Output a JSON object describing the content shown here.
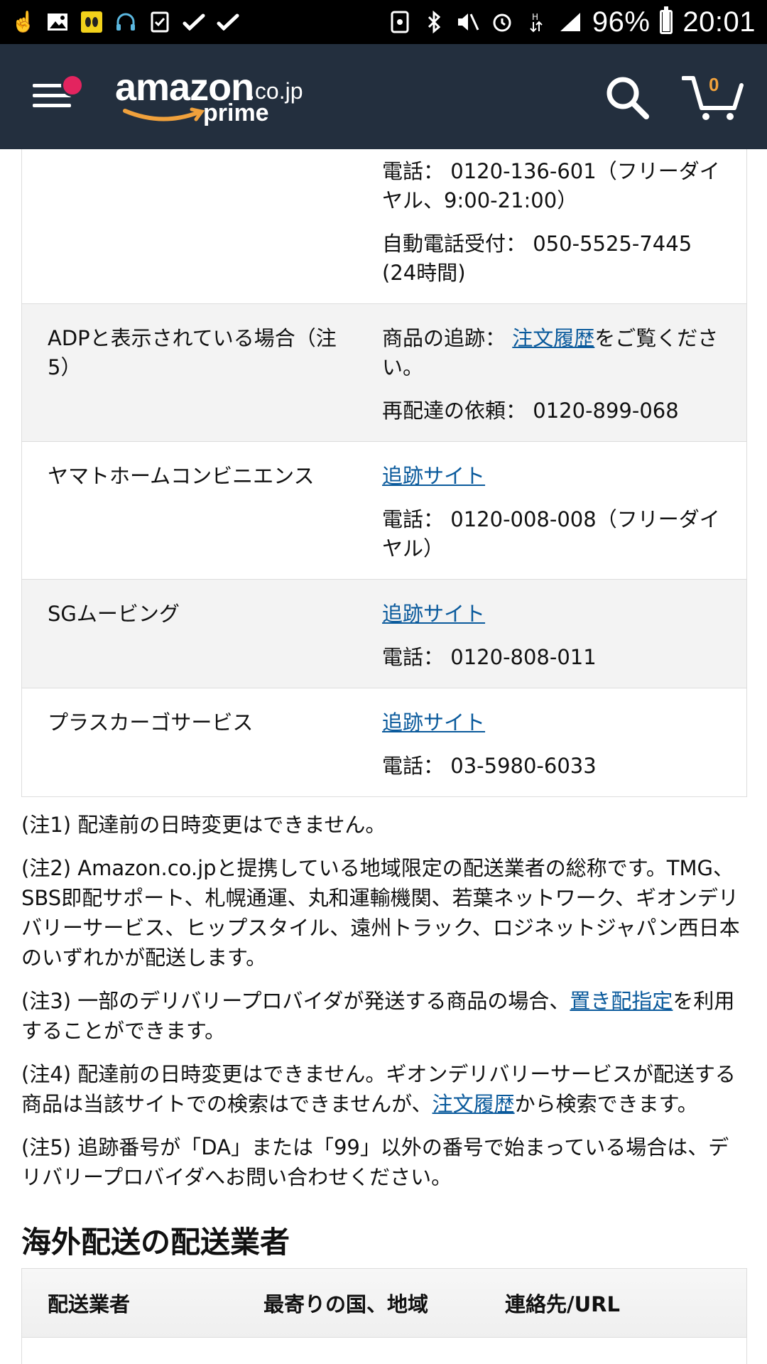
{
  "status_bar": {
    "battery_percent": "96%",
    "battery_level": 0.96,
    "time": "20:01"
  },
  "header": {
    "logo_word": "amazon",
    "logo_tld": ".co.jp",
    "logo_prime": "prime",
    "cart_count": "0"
  },
  "carriers": [
    {
      "name": "",
      "alt": false,
      "info": [
        {
          "prefix": "電話： 0120-136-601（フリーダイヤル、9:00-21:00）",
          "link": "",
          "suffix": ""
        },
        {
          "prefix": "自動電話受付： 050-5525-7445 (24時間)",
          "link": "",
          "suffix": ""
        }
      ]
    },
    {
      "name": "ADPと表示されている場合（注5）",
      "alt": true,
      "info": [
        {
          "prefix": "商品の追跡： ",
          "link": "注文履歴",
          "suffix": "をご覧ください。"
        },
        {
          "prefix": "再配達の依頼： 0120-899-068",
          "link": "",
          "suffix": ""
        }
      ]
    },
    {
      "name": "ヤマトホームコンビニエンス",
      "alt": false,
      "info": [
        {
          "prefix": "",
          "link": "追跡サイト",
          "suffix": ""
        },
        {
          "prefix": "電話： 0120-008-008（フリーダイヤル）",
          "link": "",
          "suffix": ""
        }
      ]
    },
    {
      "name": "SGムービング",
      "alt": true,
      "info": [
        {
          "prefix": "",
          "link": "追跡サイト",
          "suffix": ""
        },
        {
          "prefix": "電話： 0120-808-011",
          "link": "",
          "suffix": ""
        }
      ]
    },
    {
      "name": "プラスカーゴサービス",
      "alt": false,
      "info": [
        {
          "prefix": "",
          "link": "追跡サイト",
          "suffix": ""
        },
        {
          "prefix": "電話： 03-5980-6033",
          "link": "",
          "suffix": ""
        }
      ]
    }
  ],
  "notes": [
    {
      "prefix": "(注1) 配達前の日時変更はできません。",
      "link": "",
      "suffix": ""
    },
    {
      "prefix": "(注2) Amazon.co.jpと提携している地域限定の配送業者の総称です。TMG、SBS即配サポート、札幌通運、丸和運輸機関、若葉ネットワーク、ギオンデリバリーサービス、ヒップスタイル、遠州トラック、ロジネットジャパン西日本のいずれかが配送します。",
      "link": "",
      "suffix": ""
    },
    {
      "prefix": "(注3) 一部のデリバリープロバイダが発送する商品の場合、",
      "link": "置き配指定",
      "suffix": "を利用することができます。"
    },
    {
      "prefix": "(注4) 配達前の日時変更はできません。ギオンデリバリーサービスが配送する商品は当該サイトでの検索はできませんが、",
      "link": "注文履歴",
      "suffix": "から検索できます。"
    },
    {
      "prefix": "(注5) 追跡番号が「DA」または「99」以外の番号で始まっている場合は、デリバリープロバイダへお問い合わせください。",
      "link": "",
      "suffix": ""
    }
  ],
  "international": {
    "title": "海外配送の配送業者",
    "columns": [
      "配送業者",
      "最寄りの国、地域",
      "連絡先/URL"
    ]
  },
  "colors": {
    "header_bg": "#232f3e",
    "link": "#0a5a9c",
    "cart_count": "#f0a13c",
    "menu_badge": "#e3245f",
    "smile": "#f0a13c"
  }
}
